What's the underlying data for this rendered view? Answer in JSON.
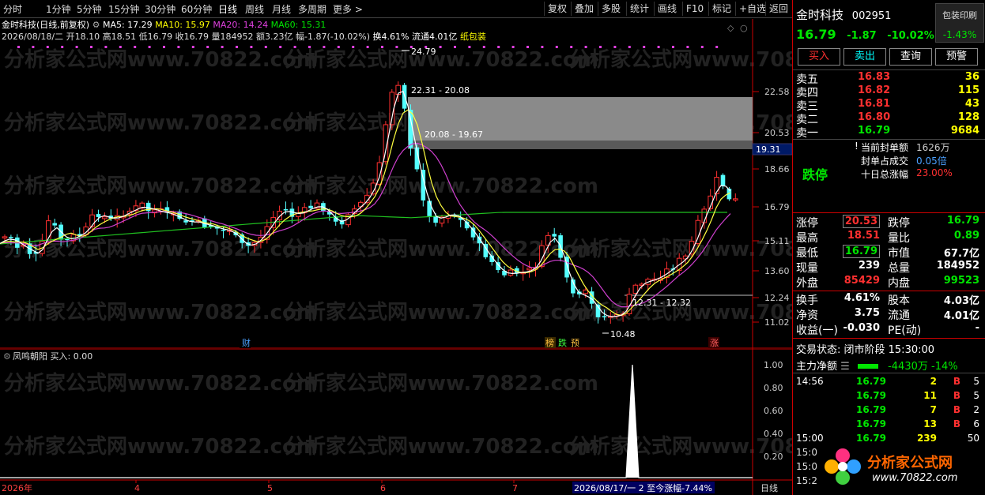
{
  "toolbar": {
    "periods": [
      "分时",
      "1分钟",
      "5分钟",
      "15分钟",
      "30分钟",
      "60分钟",
      "日线",
      "周线",
      "月线",
      "多周期",
      "更多"
    ],
    "right": [
      "复权",
      "叠加",
      "多股",
      "统计",
      "画线",
      "F10",
      "标记",
      "+自选"
    ],
    "back": "返回"
  },
  "header": {
    "title": "金时科技(日线,前复权)",
    "ma5": "MA5: 17.29",
    "ma10": "MA10: 15.97",
    "ma20": "MA20: 14.24",
    "ma60": "MA60: 15.31",
    "bar_info": "2026/08/18/二 开18.10 高18.51 低16.79 收16.79 量184952 额3.23亿 幅-1.87(-10.02%)",
    "extra": "换4.61% 流通4.01亿",
    "sector": "纸包装"
  },
  "price_axis": [
    "22.58",
    "20.53",
    "18.66",
    "16.79",
    "15.11",
    "13.60",
    "12.24",
    "11.02"
  ],
  "current_price_tag": "19.31",
  "annotations": {
    "high": "24.79",
    "zone1": "22.31 - 20.08",
    "zone2": "20.08 - 19.67",
    "zone3": "12.31 - 12.32",
    "low": "10.48",
    "tag_cai": "财",
    "tag_bang": "榜",
    "tag_die": "跌",
    "tag_yu": "预",
    "tag_zhang": "涨"
  },
  "legend": {
    "name": "金时科技"
  },
  "indicator": {
    "title": "凤鸣朝阳 买入: 0.00",
    "axis": [
      "1.00",
      "0.80",
      "0.60",
      "0.40",
      "0.20"
    ]
  },
  "date_axis": [
    "2026年",
    "4",
    "5",
    "6",
    "7"
  ],
  "date_tooltip": "2026/08/17/一 2 至今涨幅-7.44%",
  "period_label": "日线",
  "watermark": "分析家公式网www.70822.com",
  "side": {
    "name": "金时科技",
    "code": "002951",
    "badge": "包装印刷",
    "price": "16.79",
    "change": "-1.87",
    "pct": "-10.02%",
    "badge_pct": "-1.43%",
    "buttons": [
      "买入",
      "卖出",
      "查询",
      "预警"
    ],
    "asks": [
      {
        "label": "卖五",
        "price": "16.83",
        "vol": "36"
      },
      {
        "label": "卖四",
        "price": "16.82",
        "vol": "115"
      },
      {
        "label": "卖三",
        "price": "16.81",
        "vol": "43"
      },
      {
        "label": "卖二",
        "price": "16.80",
        "vol": "128"
      },
      {
        "label": "卖一",
        "price": "16.79",
        "vol": "9684"
      }
    ],
    "limit_state": "跌停",
    "seal": [
      {
        "k": "当前封单额",
        "v": "1626万"
      },
      {
        "k": "封单占成交",
        "v": "0.05倍"
      },
      {
        "k": "十日总涨幅",
        "v": "23.00%"
      }
    ],
    "stats": [
      {
        "k1": "涨停",
        "v1": "20.53",
        "k2": "跌停",
        "v2": "16.79"
      },
      {
        "k1": "最高",
        "v1": "18.51",
        "k2": "量比",
        "v2": "0.89"
      },
      {
        "k1": "最低",
        "v1": "16.79",
        "k2": "市值",
        "v2": "67.7亿"
      },
      {
        "k1": "现量",
        "v1": "239",
        "k2": "总量",
        "v2": "184952"
      },
      {
        "k1": "外盘",
        "v1": "85429",
        "k2": "内盘",
        "v2": "99523"
      }
    ],
    "stats2": [
      {
        "k1": "换手",
        "v1": "4.61%",
        "k2": "股本",
        "v2": "4.03亿"
      },
      {
        "k1": "净资",
        "v1": "3.75",
        "k2": "流通",
        "v2": "4.01亿"
      },
      {
        "k1": "收益(一)",
        "v1": "-0.030",
        "k2": "PE(动)",
        "v2": "-"
      }
    ],
    "trade_state": "交易状态: 闭市阶段 15:30:00",
    "net_label": "主力净额",
    "net_value": "-4430万",
    "net_pct": "-14%",
    "ticks": [
      {
        "t": "14:56",
        "p": "16.79",
        "v": "2",
        "d": "B",
        "n": "5"
      },
      {
        "t": "",
        "p": "16.79",
        "v": "11",
        "d": "B",
        "n": "5"
      },
      {
        "t": "",
        "p": "16.79",
        "v": "7",
        "d": "B",
        "n": "2"
      },
      {
        "t": "",
        "p": "16.79",
        "v": "13",
        "d": "B",
        "n": "6"
      },
      {
        "t": "15:00",
        "p": "16.79",
        "v": "239",
        "d": "",
        "n": "50"
      }
    ],
    "logo": "分析家公式网",
    "logo_url": "www.70822.com",
    "tick_times_extra": [
      "15:0",
      "15:0",
      "15:2"
    ]
  }
}
